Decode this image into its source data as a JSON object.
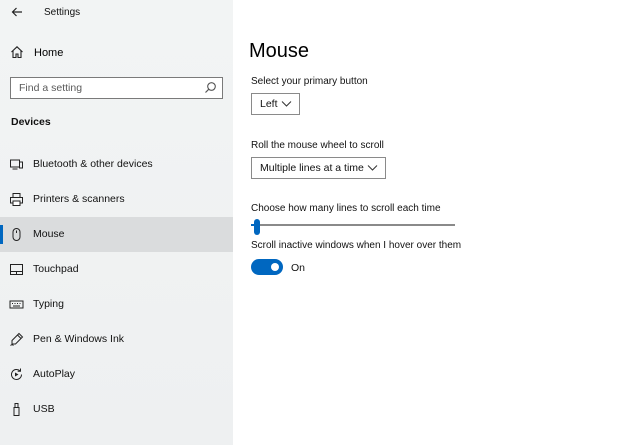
{
  "window": {
    "title": "Settings"
  },
  "sidebar": {
    "home_label": "Home",
    "search_placeholder": "Find a setting",
    "section_title": "Devices",
    "items": [
      {
        "label": "Bluetooth & other devices",
        "icon": "bluetooth-devices-icon"
      },
      {
        "label": "Printers & scanners",
        "icon": "printer-icon"
      },
      {
        "label": "Mouse",
        "icon": "mouse-icon",
        "selected": true
      },
      {
        "label": "Touchpad",
        "icon": "touchpad-icon"
      },
      {
        "label": "Typing",
        "icon": "keyboard-icon"
      },
      {
        "label": "Pen & Windows Ink",
        "icon": "pen-icon"
      },
      {
        "label": "AutoPlay",
        "icon": "autoplay-icon"
      },
      {
        "label": "USB",
        "icon": "usb-icon"
      }
    ]
  },
  "main": {
    "title": "Mouse",
    "primary_button": {
      "label": "Select your primary button",
      "value": "Left"
    },
    "wheel": {
      "label": "Roll the mouse wheel to scroll",
      "value": "Multiple lines at a time"
    },
    "lines": {
      "label": "Choose how many lines to scroll each time",
      "fraction": 0.03
    },
    "inactive": {
      "label": "Scroll inactive windows when I hover over them",
      "state": "On",
      "on": true
    }
  },
  "colors": {
    "accent": "#0067c0",
    "sidebar_bg": "#f0f2f3",
    "selected_bg": "#dadcdd"
  }
}
